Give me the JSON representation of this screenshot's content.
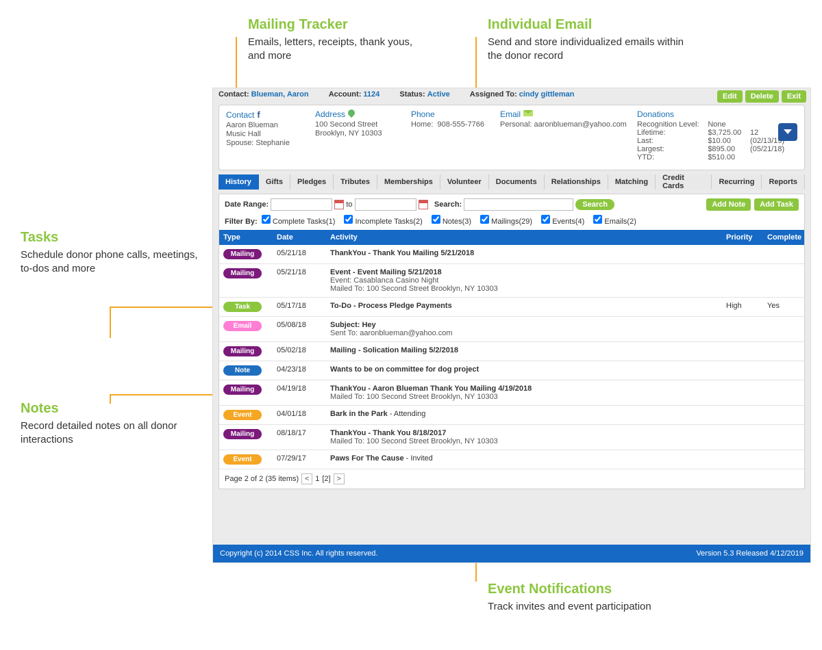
{
  "callouts": {
    "mailing": {
      "title": "Mailing Tracker",
      "body": "Emails, letters, receipts, thank yous, and more"
    },
    "indivEmail": {
      "title": "Individual Email",
      "body": "Send and store individualized emails within the donor record"
    },
    "tasks": {
      "title": "Tasks",
      "body": "Schedule donor phone calls, meetings, to-dos and more"
    },
    "notes": {
      "title": "Notes",
      "body": "Record detailed notes on all donor interactions"
    },
    "eventNotif": {
      "title": "Event Notifications",
      "body": "Track invites and event participation"
    }
  },
  "toprow": {
    "contact_label": "Contact:",
    "contact_value": "Blueman, Aaron",
    "account_label": "Account:",
    "account_value": "1124",
    "status_label": "Status:",
    "status_value": "Active",
    "assigned_label": "Assigned To:",
    "assigned_value": "cindy gittleman",
    "edit": "Edit",
    "delete": "Delete",
    "exit": "Exit"
  },
  "card": {
    "contact": {
      "h": "Contact",
      "l1": "Aaron Blueman",
      "l2": "Music Hall",
      "l3": "Spouse: Stephanie"
    },
    "address": {
      "h": "Address",
      "l1": "100 Second Street",
      "l2": "Brooklyn, NY 10303"
    },
    "phone": {
      "h": "Phone",
      "l1_label": "Home:",
      "l1_val": "908-555-7766"
    },
    "email": {
      "h": "Email",
      "l1_label": "Personal:",
      "l1_val": "aaronblueman@yahoo.com"
    },
    "donations": {
      "h": "Donations",
      "rows": {
        "recognition": {
          "k": "Recognition Level:",
          "v": "None",
          "v2": ""
        },
        "lifetime": {
          "k": "Lifetime:",
          "v": "$3,725.00",
          "v2": "12"
        },
        "last": {
          "k": "Last:",
          "v": "$10.00",
          "v2": "(02/13/19)"
        },
        "largest": {
          "k": "Largest:",
          "v": "$895.00",
          "v2": "(05/21/18)"
        },
        "ytd": {
          "k": "YTD:",
          "v": "$510.00",
          "v2": ""
        }
      }
    }
  },
  "tabs": [
    "History",
    "Gifts",
    "Pledges",
    "Tributes",
    "Memberships",
    "Volunteer",
    "Documents",
    "Relationships",
    "Matching",
    "Credit Cards",
    "Recurring",
    "Reports"
  ],
  "filter": {
    "dateRange": "Date Range:",
    "to": "to",
    "search_label": "Search:",
    "search_btn": "Search",
    "addNote": "Add Note",
    "addTask": "Add Task",
    "filterBy": "Filter By:",
    "chk": {
      "complete": "Complete Tasks(1)",
      "incomplete": "Incomplete Tasks(2)",
      "notes": "Notes(3)",
      "mailings": "Mailings(29)",
      "events": "Events(4)",
      "emails": "Emails(2)"
    }
  },
  "gridhead": {
    "type": "Type",
    "date": "Date",
    "activity": "Activity",
    "priority": "Priority",
    "complete": "Complete"
  },
  "rows": [
    {
      "type": "Mailing",
      "cls": "mailing",
      "date": "05/21/18",
      "title": "ThankYou - Thank You Mailing 5/21/2018",
      "sub": "",
      "pri": "",
      "comp": ""
    },
    {
      "type": "Mailing",
      "cls": "mailing",
      "date": "05/21/18",
      "title": "Event - Event Mailing 5/21/2018",
      "sub": "Event: Casablanca Casino Night\nMailed To: 100 Second Street Brooklyn, NY 10303",
      "pri": "",
      "comp": ""
    },
    {
      "type": "Task",
      "cls": "task",
      "date": "05/17/18",
      "title": "To-Do - Process Pledge Payments",
      "sub": "",
      "pri": "High",
      "comp": "Yes"
    },
    {
      "type": "Email",
      "cls": "email",
      "date": "05/08/18",
      "title": "Subject: Hey",
      "sub": "Sent To: aaronblueman@yahoo.com",
      "pri": "",
      "comp": ""
    },
    {
      "type": "Mailing",
      "cls": "mailing",
      "date": "05/02/18",
      "title": "Mailing - Solication Mailing 5/2/2018",
      "sub": "",
      "pri": "",
      "comp": ""
    },
    {
      "type": "Note",
      "cls": "note",
      "date": "04/23/18",
      "title": "Wants to be on committee for dog project",
      "sub": "",
      "pri": "",
      "comp": ""
    },
    {
      "type": "Mailing",
      "cls": "mailing",
      "date": "04/19/18",
      "title": "ThankYou - Aaron Blueman Thank You Mailing 4/19/2018",
      "sub": "Mailed To: 100 Second Street Brooklyn, NY 10303",
      "pri": "",
      "comp": ""
    },
    {
      "type": "Event",
      "cls": "event",
      "date": "04/01/18",
      "title": "Bark in the Park",
      "titleSuffix": " - Attending",
      "sub": "",
      "pri": "",
      "comp": ""
    },
    {
      "type": "Mailing",
      "cls": "mailing",
      "date": "08/18/17",
      "title": "ThankYou - Thank You 8/18/2017",
      "sub": "Mailed To: 100 Second Street Brooklyn, NY 10303",
      "pri": "",
      "comp": ""
    },
    {
      "type": "Event",
      "cls": "event",
      "date": "07/29/17",
      "title": "Paws For The Cause",
      "titleSuffix": " - Invited",
      "sub": "",
      "pri": "",
      "comp": ""
    }
  ],
  "pager": {
    "text": "Page 2 of 2 (35 items)",
    "p1": "1",
    "p2": "[2]"
  },
  "footer": {
    "left": "Copyright (c) 2014 CSS Inc. All rights reserved.",
    "right": "Version 5.3 Released 4/12/2019"
  }
}
